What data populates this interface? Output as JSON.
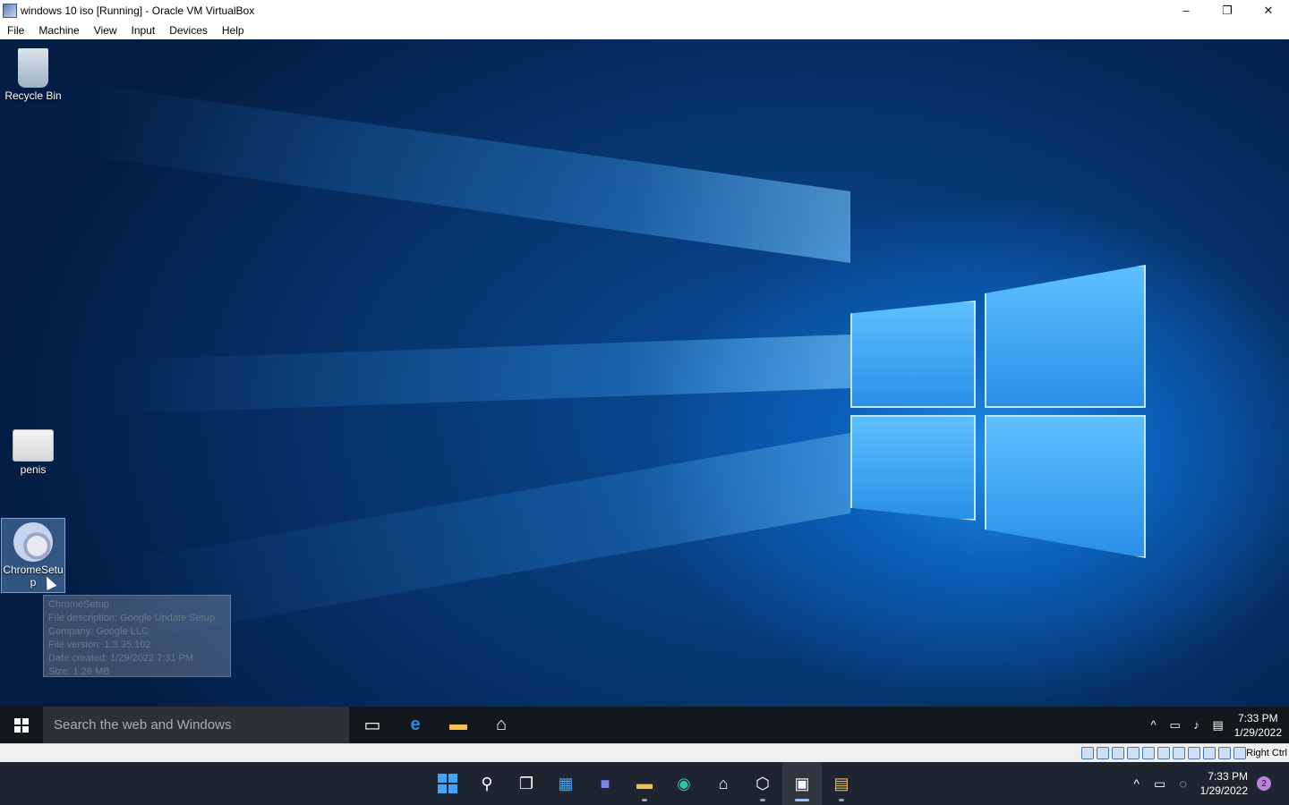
{
  "window": {
    "title": "windows 10 iso [Running] - Oracle VM VirtualBox",
    "controls": {
      "minimize": "–",
      "restore": "❐",
      "close": "✕"
    }
  },
  "menu": [
    "File",
    "Machine",
    "View",
    "Input",
    "Devices",
    "Help"
  ],
  "desktop": {
    "icons": [
      {
        "label": "Recycle Bin",
        "icon": "recycle-bin-icon"
      },
      {
        "label": "penis",
        "icon": "certificate-icon"
      },
      {
        "label": "ChromeSetup",
        "icon": "installer-icon"
      }
    ],
    "tooltip": [
      "ChromeSetup",
      "File description: Google Update Setup",
      "Company: Google LLC",
      "File version: 1.3.35.102",
      "Date created: 1/29/2022 7:31 PM",
      "Size: 1.26 MB"
    ]
  },
  "guest_taskbar": {
    "search_placeholder": "Search the web and Windows",
    "clock_time": "7:33 PM",
    "clock_date": "1/29/2022"
  },
  "statusbar": {
    "host_key": "Right Ctrl"
  },
  "host_taskbar": {
    "clock_time": "7:33 PM",
    "clock_date": "1/29/2022",
    "notification_count": "2"
  },
  "colors": {
    "desktop_blue": "#0a4f9c",
    "taskbar": "#12161d",
    "host_taskbar": "#1f2530",
    "accent": "#3ea4f5"
  }
}
